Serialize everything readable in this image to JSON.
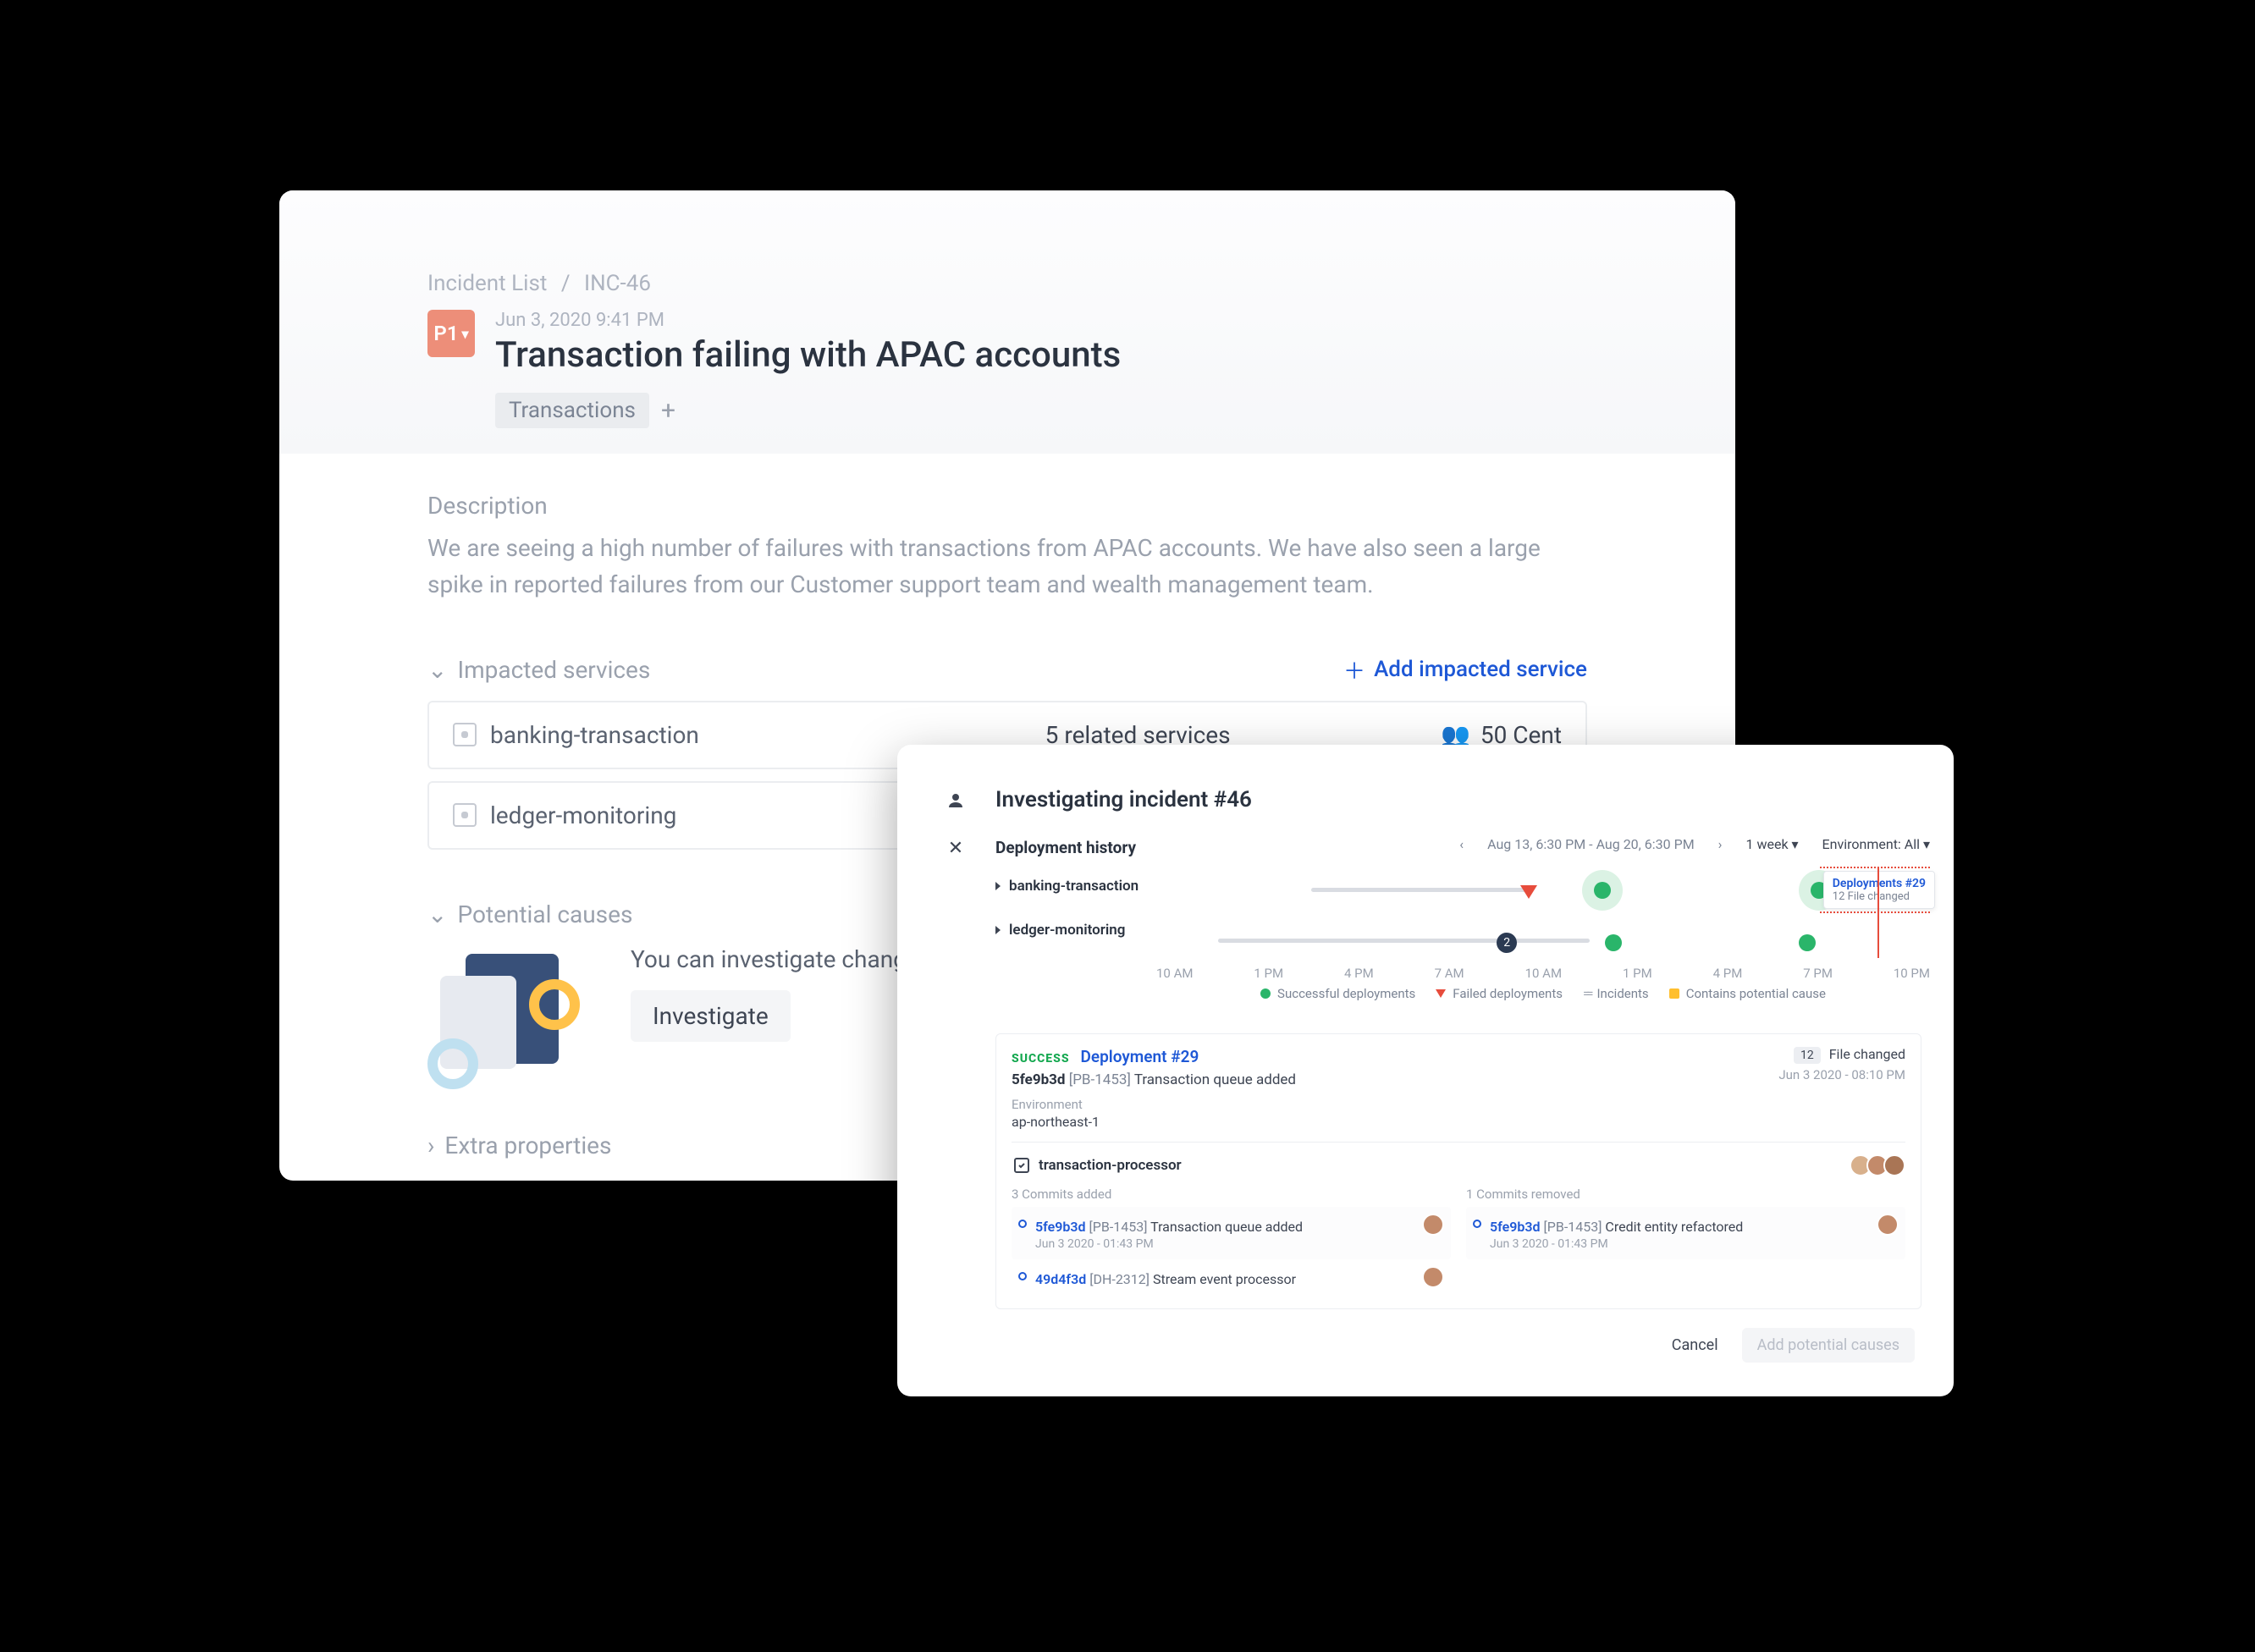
{
  "breadcrumb": {
    "root": "Incident List",
    "id": "INC-46"
  },
  "header": {
    "priority": "P1",
    "timestamp": "Jun 3, 2020 9:41 PM",
    "title": "Transaction failing with APAC accounts",
    "tags": [
      "Transactions"
    ]
  },
  "description": {
    "label": "Description",
    "text": "We are seeing a high number of failures with transactions from APAC accounts. We have also seen a large spike in reported failures from our Customer support team and wealth management team."
  },
  "impacted": {
    "label": "Impacted services",
    "add_label": "Add impacted service",
    "services": [
      {
        "name": "banking-transaction",
        "related": "5 related services",
        "oncall": "50 Cent"
      },
      {
        "name": "ledger-monitoring",
        "related": "",
        "oncall": ""
      }
    ]
  },
  "causes": {
    "label": "Potential causes",
    "text": "You can investigate changes to services to find possible causes.",
    "button": "Investigate"
  },
  "extra": {
    "label": "Extra properties"
  },
  "modal": {
    "title": "Investigating incident #46",
    "history_label": "Deployment history",
    "services": [
      "banking-transaction",
      "ledger-monitoring"
    ],
    "range": {
      "text": "Aug 13, 6:30 PM - Aug 20, 6:30 PM",
      "window": "1 week",
      "env": "Environment: All"
    },
    "ticks": [
      "10 AM",
      "1 PM",
      "4 PM",
      "7 AM",
      "10 AM",
      "1 PM",
      "4 PM",
      "7 PM",
      "10 PM"
    ],
    "overflow": "2",
    "tooltip": {
      "title": "Deployments #29",
      "sub": "12 File changed"
    },
    "legend": {
      "success": "Successful deployments",
      "failed": "Failed deployments",
      "incidents": "Incidents",
      "potential": "Contains potential cause"
    },
    "deployment": {
      "status": "SUCCESS",
      "name": "Deployment #29",
      "sha": "5fe9b3d",
      "ticket": "[PB-1453]",
      "msg": "Transaction queue added",
      "env_label": "Environment",
      "env": "ap-northeast-1",
      "files_count": "12",
      "files_label": "File changed",
      "timestamp": "Jun 3 2020 - 08:10 PM",
      "service": "transaction-processor",
      "added_label": "3 Commits added",
      "removed_label": "1 Commits removed",
      "added": [
        {
          "sha": "5fe9b3d",
          "ticket": "[PB-1453]",
          "msg": "Transaction queue added",
          "time": "Jun 3 2020 - 01:43 PM"
        },
        {
          "sha": "49d4f3d",
          "ticket": "[DH-2312]",
          "msg": "Stream event processor",
          "time": ""
        }
      ],
      "removed": [
        {
          "sha": "5fe9b3d",
          "ticket": "[PB-1453]",
          "msg": "Credit entity refactored",
          "time": "Jun 3 2020 - 01:43 PM"
        }
      ]
    },
    "actions": {
      "cancel": "Cancel",
      "add": "Add potential causes"
    }
  }
}
